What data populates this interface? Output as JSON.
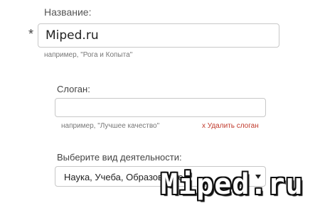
{
  "company_name": {
    "label": "Название:",
    "required_mark": "*",
    "value": "Miped.ru",
    "hint": "например, \"Рога и Копыта\""
  },
  "slogan": {
    "label": "Слоган:",
    "value": "",
    "hint": "например, \"Лучшее качество\"",
    "delete_label": "x Удалить слоган"
  },
  "activity": {
    "label": "Выберите вид деятельности:",
    "selected": "Наука, Учеба, Образование"
  },
  "watermark": "Miped.ru",
  "colors": {
    "delete_link": "#c0392b",
    "input_border": "#c8c8c8",
    "hint_text": "#777777"
  }
}
